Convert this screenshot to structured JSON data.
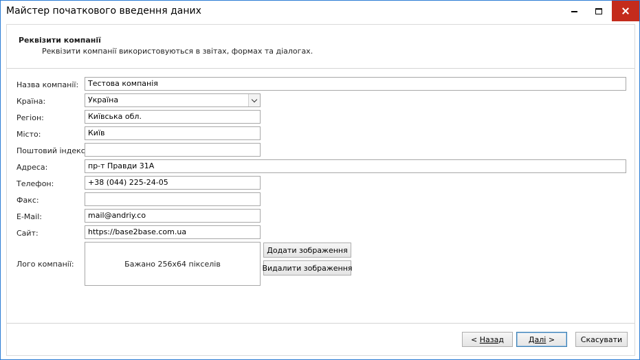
{
  "window": {
    "title": "Майстер початкового введення даних"
  },
  "header": {
    "title": "Реквізити компанії",
    "description": "Реквізити компанії використовуються в звітах, формах та діалогах."
  },
  "form": {
    "company_name": {
      "label": "Назва компанії:",
      "value": "Тестова компанія"
    },
    "country": {
      "label": "Країна:",
      "value": "Україна"
    },
    "region": {
      "label": "Регіон:",
      "value": "Київська обл."
    },
    "city": {
      "label": "Місто:",
      "value": "Київ"
    },
    "postal_code": {
      "label": "Поштовий індекс:",
      "value": ""
    },
    "address": {
      "label": "Адреса:",
      "value": "пр-т Правди 31А"
    },
    "phone": {
      "label": "Телефон:",
      "value": "+38 (044) 225-24-05"
    },
    "fax": {
      "label": "Факс:",
      "value": ""
    },
    "email": {
      "label": "E-Mail:",
      "value": "mail@andriy.co"
    },
    "site": {
      "label": "Сайт:",
      "value": "https://base2base.com.ua"
    },
    "logo": {
      "label": "Лого компанії:",
      "placeholder": "Бажано 256x64 пікселів",
      "add_button": "Додати зображення",
      "remove_button": "Видалити зображення"
    }
  },
  "footer": {
    "back_prefix": "< ",
    "back_label": "Назад",
    "next_label": "Далі",
    "next_suffix": " >",
    "cancel_label": "Скасувати"
  },
  "icons": {
    "minimize": "minimize-icon",
    "maximize": "maximize-icon",
    "close": "close-icon",
    "dropdown": "chevron-down-icon"
  },
  "colors": {
    "window_border": "#2b7bd4",
    "close_button": "#c42b1c"
  }
}
